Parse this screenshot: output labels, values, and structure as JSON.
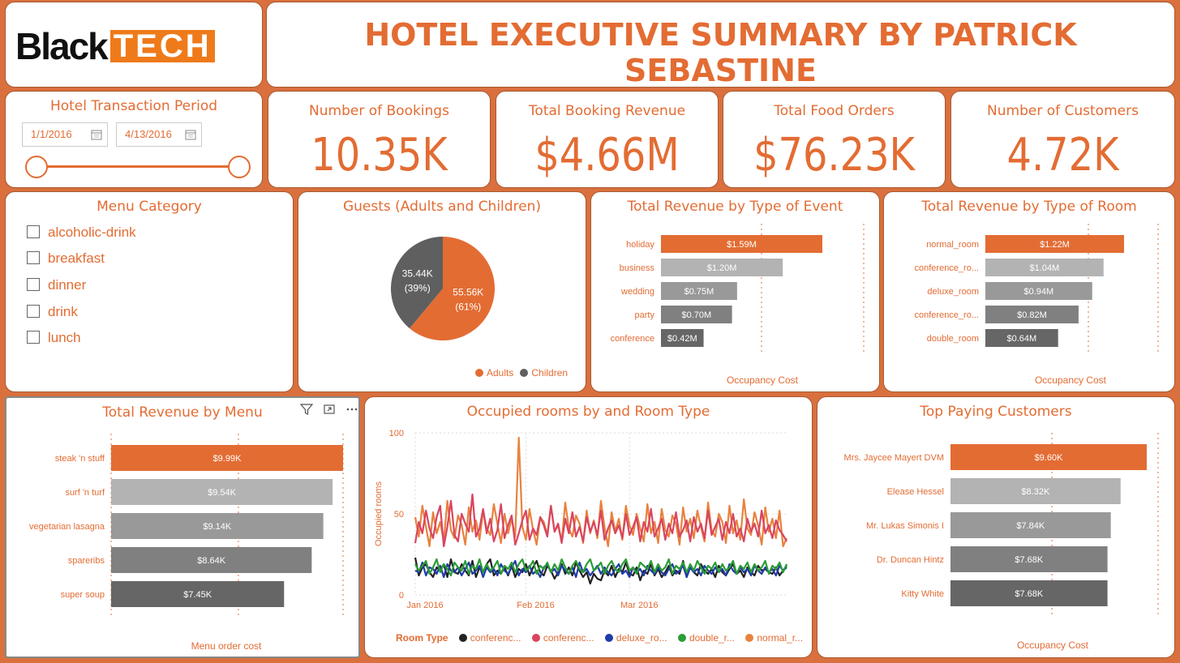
{
  "header": {
    "logo_black": "Black",
    "logo_orange": "TECH",
    "title": "HOTEL EXECUTIVE SUMMARY BY PATRICK SEBASTINE"
  },
  "period": {
    "label": "Hotel Transaction Period",
    "start": "1/1/2016",
    "end": "4/13/2016"
  },
  "kpis": [
    {
      "label": "Number of Bookings",
      "value": "10.35K"
    },
    {
      "label": "Total Booking Revenue",
      "value": "$4.66M"
    },
    {
      "label": "Total Food Orders",
      "value": "$76.23K"
    },
    {
      "label": "Number of Customers",
      "value": "4.72K"
    }
  ],
  "menu_category": {
    "title": "Menu Category",
    "items": [
      "alcoholic-drink",
      "breakfast",
      "dinner",
      "drink",
      "lunch"
    ]
  },
  "guests": {
    "title": "Guests (Adults and Children)",
    "slices": [
      {
        "name": "Adults",
        "value": 55.56,
        "label": "55.56K",
        "pct": "(61%)",
        "color": "#e36c33"
      },
      {
        "name": "Children",
        "value": 35.44,
        "label": "35.44K",
        "pct": "(39%)",
        "color": "#5f5f5f"
      }
    ],
    "legend": [
      "Adults",
      "Children"
    ]
  },
  "colors": {
    "accent": "#e36c33",
    "grey1": "#b3b3b3",
    "grey2": "#999999",
    "grey3": "#808080",
    "grey4": "#666666"
  },
  "chart_data": [
    {
      "id": "event",
      "type": "bar",
      "title": "Total Revenue by Type of Event",
      "xlabel": "Occupancy Cost",
      "categories": [
        "holiday",
        "business",
        "wedding",
        "party",
        "conference"
      ],
      "values": [
        1.59,
        1.2,
        0.75,
        0.7,
        0.42
      ],
      "labels": [
        "$1.59M",
        "$1.20M",
        "$0.75M",
        "$0.70M",
        "$0.42M"
      ]
    },
    {
      "id": "room",
      "type": "bar",
      "title": "Total Revenue by Type of Room",
      "xlabel": "Occupancy Cost",
      "categories": [
        "normal_room",
        "conference_ro...",
        "deluxe_room",
        "conference_ro...",
        "double_room"
      ],
      "values": [
        1.22,
        1.04,
        0.94,
        0.82,
        0.64
      ],
      "labels": [
        "$1.22M",
        "$1.04M",
        "$0.94M",
        "$0.82M",
        "$0.64M"
      ]
    },
    {
      "id": "menu",
      "type": "bar",
      "title": "Total Revenue by Menu",
      "xlabel": "Menu order cost",
      "categories": [
        "steak 'n stuff",
        "surf 'n turf",
        "vegetarian lasagna",
        "spareribs",
        "super soup"
      ],
      "values": [
        9.99,
        9.54,
        9.14,
        8.64,
        7.45
      ],
      "labels": [
        "$9.99K",
        "$9.54K",
        "$9.14K",
        "$8.64K",
        "$7.45K"
      ]
    },
    {
      "id": "customers",
      "type": "bar",
      "title": "Top Paying Customers",
      "xlabel": "Occupancy Cost",
      "categories": [
        "Mrs. Jaycee Mayert DVM",
        "Elease Hessel",
        "Mr. Lukas Simonis I",
        "Dr. Duncan Hintz",
        "Kitty White"
      ],
      "values": [
        9.6,
        8.32,
        7.84,
        7.68,
        7.68
      ],
      "labels": [
        "$9.60K",
        "$8.32K",
        "$7.84K",
        "$7.68K",
        "$7.68K"
      ]
    },
    {
      "id": "occupancy",
      "type": "line",
      "title": "Occupied rooms by and Room Type",
      "ylabel": "Occupied rooms",
      "ylim": [
        0,
        100
      ],
      "yticks": [
        0,
        50,
        100
      ],
      "xticks": [
        "Jan 2016",
        "Feb 2016",
        "Mar 2016"
      ],
      "legend_title": "Room Type",
      "series": [
        {
          "name": "conferenc...",
          "color": "#222222",
          "values": [
            23,
            12,
            17,
            19,
            14,
            11,
            17,
            15,
            19,
            11,
            22,
            14,
            13,
            19,
            15,
            12,
            21,
            11,
            17,
            14,
            19,
            22,
            12,
            15,
            13,
            17,
            12,
            18,
            11,
            16,
            14,
            19,
            12,
            17,
            21,
            14,
            12,
            18,
            15,
            10,
            14,
            19,
            13,
            17,
            12,
            20,
            15,
            11,
            14,
            7,
            13,
            10,
            9,
            15,
            12,
            18,
            11,
            16,
            14,
            20,
            13,
            12,
            17,
            9,
            15,
            13,
            19,
            12,
            16,
            11,
            14,
            18,
            12,
            15,
            13,
            21,
            11,
            17,
            14,
            12,
            19,
            15,
            13,
            16,
            11,
            18,
            14,
            12,
            16,
            19,
            13,
            15,
            11,
            17,
            14,
            12,
            18,
            15,
            16,
            14,
            13,
            17,
            12,
            15,
            18
          ]
        },
        {
          "name": "conferenc...",
          "color": "#d9455f",
          "values": [
            32,
            45,
            38,
            52,
            41,
            35,
            48,
            55,
            30,
            42,
            58,
            37,
            33,
            50,
            44,
            39,
            62,
            36,
            41,
            53,
            38,
            47,
            33,
            40,
            56,
            35,
            43,
            49,
            31,
            38,
            46,
            52,
            34,
            41,
            37,
            48,
            43,
            36,
            55,
            39,
            44,
            32,
            47,
            38,
            51,
            36,
            42,
            33,
            48,
            39,
            45,
            37,
            52,
            34,
            41,
            46,
            38,
            43,
            35,
            50,
            37,
            42,
            48,
            33,
            45,
            39,
            53,
            36,
            41,
            47,
            34,
            44,
            38,
            51,
            36,
            40,
            46,
            33,
            48,
            39,
            44,
            35,
            52,
            37,
            42,
            47,
            34,
            45,
            38,
            50,
            36,
            41,
            33,
            47,
            39,
            44,
            36,
            52,
            38,
            43,
            35,
            46,
            40,
            37,
            33
          ]
        },
        {
          "name": "deluxe_ro...",
          "color": "#1f3ca8",
          "values": [
            15,
            14,
            20,
            12,
            17,
            16,
            13,
            18,
            11,
            19,
            15,
            14,
            17,
            12,
            16,
            20,
            13,
            15,
            18,
            11,
            17,
            14,
            16,
            12,
            19,
            15,
            13,
            17,
            21,
            12,
            16,
            14,
            18,
            13,
            15,
            11,
            17,
            19,
            14,
            16,
            12,
            18,
            15,
            13,
            17,
            11,
            20,
            14,
            16,
            12,
            15,
            18,
            13,
            17,
            14,
            12,
            16,
            19,
            13,
            15,
            11,
            17,
            14,
            16,
            12,
            18,
            15,
            13,
            17,
            14,
            12,
            16,
            19,
            13,
            15,
            18,
            11,
            17,
            14,
            16,
            12,
            18,
            15,
            13,
            17,
            14,
            16,
            12,
            19,
            15,
            13,
            17,
            14,
            16,
            12,
            18,
            15,
            13,
            17,
            14,
            16,
            12,
            18,
            15,
            17
          ]
        },
        {
          "name": "double_r...",
          "color": "#2a9d35",
          "values": [
            19,
            15,
            18,
            21,
            13,
            17,
            22,
            14,
            19,
            16,
            12,
            20,
            17,
            15,
            21,
            13,
            18,
            16,
            22,
            14,
            19,
            15,
            17,
            21,
            13,
            18,
            16,
            20,
            14,
            19,
            22,
            15,
            17,
            21,
            13,
            18,
            16,
            20,
            14,
            19,
            15,
            22,
            17,
            13,
            18,
            21,
            16,
            14,
            19,
            22,
            15,
            17,
            20,
            13,
            18,
            21,
            16,
            14,
            19,
            22,
            15,
            17,
            13,
            20,
            18,
            16,
            21,
            14,
            19,
            15,
            17,
            22,
            13,
            18,
            16,
            20,
            14,
            19,
            15,
            21,
            17,
            13,
            18,
            16,
            20,
            14,
            19,
            15,
            17,
            21,
            13,
            18,
            16,
            20,
            14,
            19,
            15,
            17,
            21,
            13,
            18,
            16,
            20,
            14,
            19
          ]
        },
        {
          "name": "normal_r...",
          "color": "#e8823e",
          "values": [
            48,
            36,
            55,
            42,
            30,
            51,
            38,
            45,
            33,
            58,
            40,
            35,
            49,
            43,
            31,
            54,
            39,
            46,
            34,
            52,
            41,
            37,
            56,
            44,
            32,
            50,
            38,
            47,
            36,
            97,
            42,
            34,
            53,
            40,
            31,
            48,
            45,
            37,
            55,
            39,
            43,
            33,
            57,
            41,
            36,
            49,
            44,
            32,
            52,
            38,
            46,
            35,
            58,
            42,
            30,
            51,
            39,
            47,
            34,
            55,
            43,
            37,
            50,
            41,
            33,
            56,
            38,
            45,
            32,
            53,
            40,
            36,
            49,
            44,
            31,
            54,
            39,
            47,
            35,
            52,
            42,
            33,
            57,
            40,
            36,
            50,
            45,
            32,
            55,
            38,
            46,
            34,
            59,
            41,
            37,
            51,
            43,
            31,
            54,
            39,
            47,
            35,
            52,
            30,
            35
          ]
        }
      ]
    }
  ]
}
